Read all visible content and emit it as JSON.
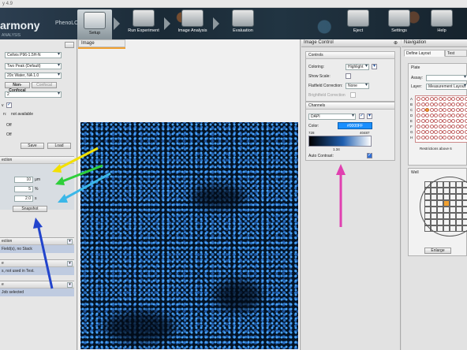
{
  "window": {
    "title": "y 4.9"
  },
  "brand": {
    "name": "armony",
    "product": "PhenoLOGIC",
    "tagline": "ANALYSIS"
  },
  "toolbar": {
    "setup": "Setup",
    "run_experiment": "Run Experiment",
    "image_analysis": "Image Analysis",
    "evaluation": "Evaluation",
    "eject": "Eject",
    "settings": "Settings",
    "help": "Help"
  },
  "left_panel": {
    "plate_type": "Cellvis P96-1.5H-N",
    "autofocus": "Two Peak (Default)",
    "objective": "20x Water, NA 1.0",
    "mode_nonconfocal": "Non-Confocal",
    "mode_confocal": "Confocal",
    "binning": "2",
    "status_label": "n:",
    "status_value": "not available",
    "off1": "Off",
    "off2": "Off",
    "save_button": "Save",
    "load_button": "Load",
    "section_selection": "ection",
    "height_value": "10",
    "height_unit": "µm",
    "percent_value": "5",
    "percent_unit": "%",
    "exposure_value": "2.0",
    "exposure_unit": "s",
    "snapshot_button": "Snapshot",
    "section2_title": "ection",
    "section2_value": "Field(s), no Stack",
    "section3_title": "e",
    "section3_value": "s, not used in Test.",
    "section4_title": "e",
    "section4_value": "Job selected"
  },
  "image_pane": {
    "tab": "Image"
  },
  "image_control": {
    "title": "Image Control",
    "controls_title": "Controls",
    "coloring_label": "Coloring:",
    "coloring_value": "Highlight",
    "show_scale_label": "Show Scale:",
    "flatfield_label": "Flatfield Correction:",
    "flatfield_value": "None",
    "brightfield_label": "Brightfield Correction",
    "channels_title": "Channels",
    "channel_name": "DAPI",
    "color_label": "Color:",
    "color_value": "#0000FF",
    "hist_min": "728",
    "hist_max": "40487",
    "hist_mark": "1.34",
    "auto_contrast_label": "Auto Contrast:"
  },
  "navigation": {
    "title": "Navigation",
    "tab_define_layout": "Define Layout",
    "tab_test": "Test",
    "plate_title": "Plate",
    "assay_label": "Assay:",
    "layer_label": "Layer:",
    "layer_value": "Measurement Layout",
    "restrictions_text": "Restrictions above 6",
    "well_title": "Well",
    "enlarge_button": "Enlarge",
    "plate_rows": [
      "A",
      "B",
      "C",
      "D",
      "E",
      "F",
      "G",
      "H"
    ]
  },
  "annotation_colors": [
    "#f3e000",
    "#2ecf3a",
    "#3ab7e8",
    "#2244cc",
    "#e040b0"
  ]
}
